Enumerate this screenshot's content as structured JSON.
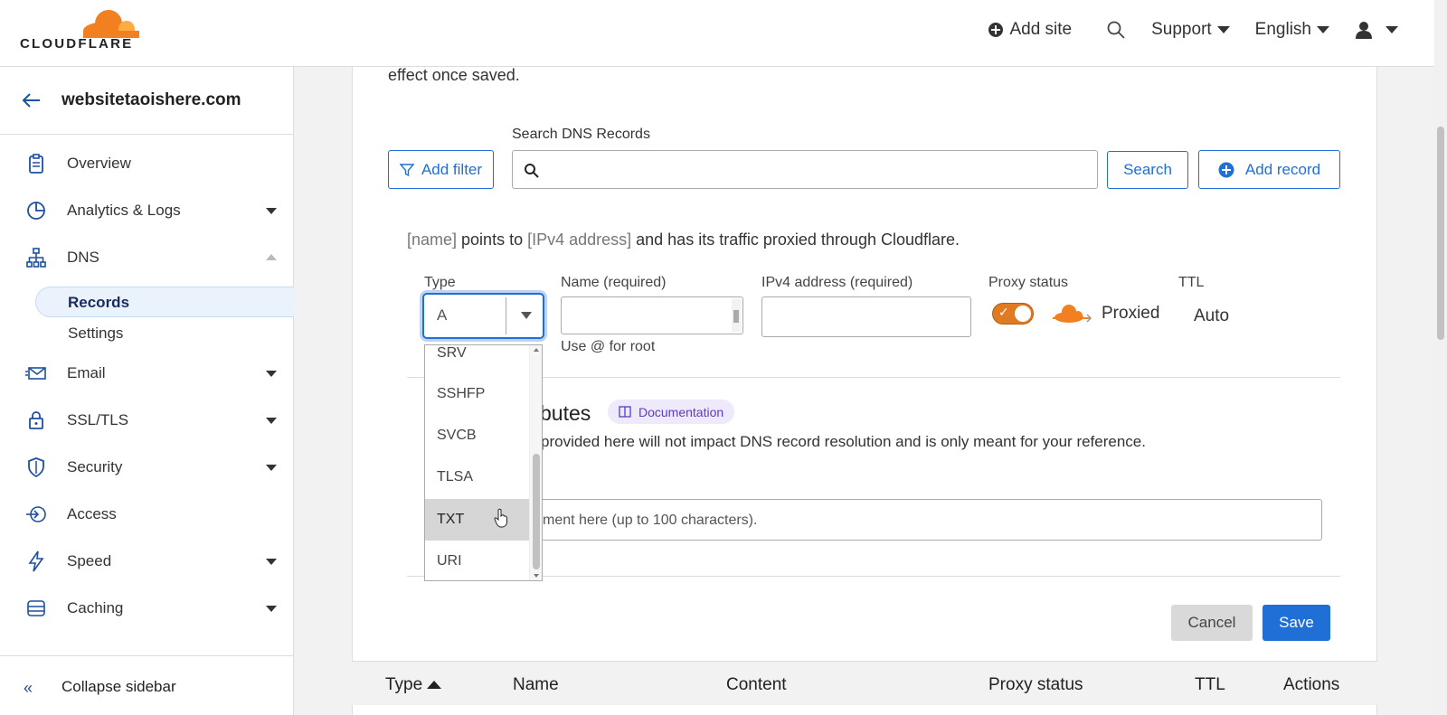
{
  "brand": {
    "logo_text": "CLOUDFLARE",
    "accent": "#f38020"
  },
  "topnav": {
    "add_site": "Add site",
    "support": "Support",
    "language": "English"
  },
  "sidebar": {
    "site_name": "websitetaoishere.com",
    "items": [
      {
        "label": "Overview",
        "icon": "clipboard-icon"
      },
      {
        "label": "Analytics & Logs",
        "icon": "pie-chart-icon"
      },
      {
        "label": "DNS",
        "icon": "network-icon"
      },
      {
        "label": "Email",
        "icon": "mail-icon"
      },
      {
        "label": "SSL/TLS",
        "icon": "lock-icon"
      },
      {
        "label": "Security",
        "icon": "shield-icon"
      },
      {
        "label": "Access",
        "icon": "access-icon"
      },
      {
        "label": "Speed",
        "icon": "lightning-icon"
      },
      {
        "label": "Caching",
        "icon": "server-icon"
      }
    ],
    "dns_sub": {
      "records": "Records",
      "settings": "Settings"
    },
    "collapse_label": "Collapse sidebar"
  },
  "main": {
    "intro_tail": "effect once saved.",
    "add_filter": "Add filter",
    "search_label": "Search DNS Records",
    "search_placeholder": "",
    "search_button": "Search",
    "add_record": "Add record",
    "info": {
      "name": "[name]",
      "mid1": " points to ",
      "ipv4": "[IPv4 address]",
      "mid2": " and has its traffic proxied through Cloudflare."
    },
    "form": {
      "type_label": "Type",
      "type_value": "A",
      "name_label": "Name (required)",
      "name_hint": "Use @ for root",
      "ipv4_label": "IPv4 address (required)",
      "proxy_label": "Proxy status",
      "proxy_value": "Proxied",
      "ttl_label": "TTL",
      "ttl_value": "Auto"
    },
    "attributes": {
      "title_fragment": "butes",
      "doc_badge": "Documentation",
      "desc_fragment": "provided here will not impact DNS record resolution and is only meant for your reference.",
      "comment_fragment": "ment here (up to 100 characters)."
    },
    "type_options": [
      "SRV",
      "SSHFP",
      "SVCB",
      "TLSA",
      "TXT",
      "URI"
    ],
    "type_highlighted": "TXT",
    "cancel": "Cancel",
    "save": "Save",
    "table_headers": [
      "Type",
      "Name",
      "Content",
      "Proxy status",
      "TTL",
      "Actions"
    ]
  }
}
